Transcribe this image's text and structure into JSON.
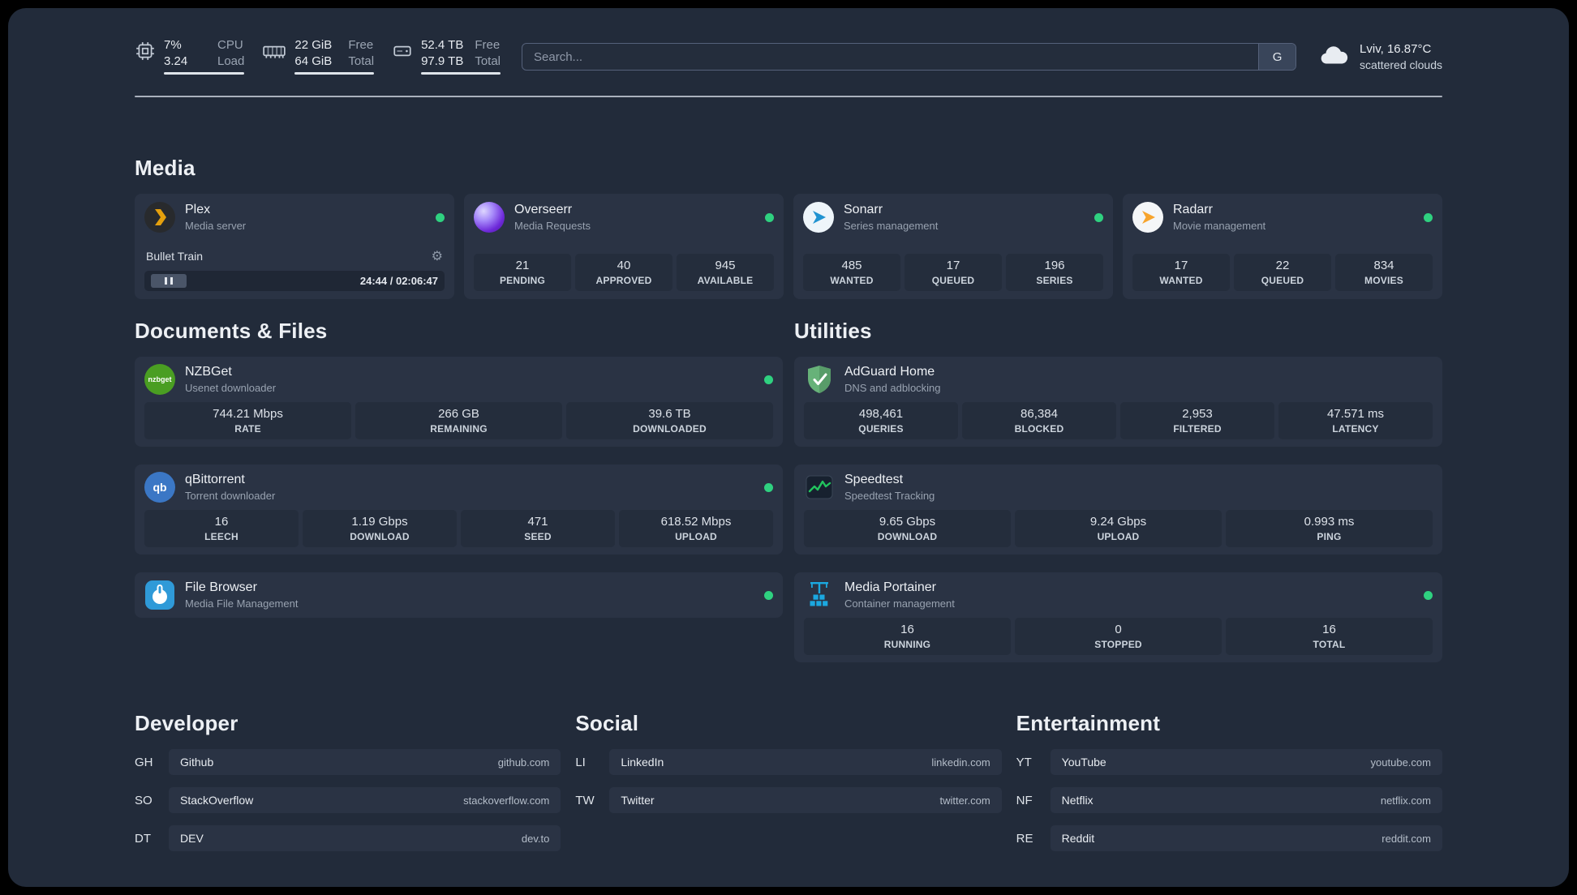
{
  "colors": {
    "status_online": "#2fd180",
    "plex_gold": "#e5a00d",
    "sonarr_blue": "#2193d1",
    "radarr_orange": "#f7a42d",
    "nzbget_green": "#4a9e22",
    "qbittorrent_blue": "#3b77c5",
    "overseerr_purple": "#6d28d9",
    "adguard_green": "#67b279",
    "speedtest_green": "#22c55e",
    "portainer_blue": "#1ba8e0",
    "filebrowser_blue": "#2f9ad8"
  },
  "topbar": {
    "cpu": {
      "rows": [
        {
          "value": "7%",
          "label": "CPU"
        },
        {
          "value": "3.24",
          "label": "Load"
        }
      ]
    },
    "memory": {
      "rows": [
        {
          "value": "22 GiB",
          "label": "Free"
        },
        {
          "value": "64 GiB",
          "label": "Total"
        }
      ]
    },
    "disk": {
      "rows": [
        {
          "value": "52.4 TB",
          "label": "Free"
        },
        {
          "value": "97.9 TB",
          "label": "Total"
        }
      ]
    },
    "search": {
      "placeholder": "Search...",
      "provider_button": "G"
    },
    "weather": {
      "location": "Lviv, 16.87°C",
      "condition": "scattered clouds"
    }
  },
  "icons": {
    "nzbget_text": "nzbget",
    "qbittorrent_text": "qb"
  },
  "sections": {
    "media": {
      "title": "Media",
      "plex": {
        "name": "Plex",
        "subtitle": "Media server",
        "now_playing": "Bullet Train",
        "time": "24:44 / 02:06:47"
      },
      "overseerr": {
        "name": "Overseerr",
        "subtitle": "Media Requests",
        "stats": [
          {
            "value": "21",
            "label": "PENDING"
          },
          {
            "value": "40",
            "label": "APPROVED"
          },
          {
            "value": "945",
            "label": "AVAILABLE"
          }
        ]
      },
      "sonarr": {
        "name": "Sonarr",
        "subtitle": "Series management",
        "stats": [
          {
            "value": "485",
            "label": "WANTED"
          },
          {
            "value": "17",
            "label": "QUEUED"
          },
          {
            "value": "196",
            "label": "SERIES"
          }
        ]
      },
      "radarr": {
        "name": "Radarr",
        "subtitle": "Movie management",
        "stats": [
          {
            "value": "17",
            "label": "WANTED"
          },
          {
            "value": "22",
            "label": "QUEUED"
          },
          {
            "value": "834",
            "label": "MOVIES"
          }
        ]
      }
    },
    "documents": {
      "title": "Documents & Files",
      "nzbget": {
        "name": "NZBGet",
        "subtitle": "Usenet downloader",
        "stats": [
          {
            "value": "744.21 Mbps",
            "label": "RATE"
          },
          {
            "value": "266 GB",
            "label": "REMAINING"
          },
          {
            "value": "39.6 TB",
            "label": "DOWNLOADED"
          }
        ]
      },
      "qbittorrent": {
        "name": "qBittorrent",
        "subtitle": "Torrent downloader",
        "stats": [
          {
            "value": "16",
            "label": "LEECH"
          },
          {
            "value": "1.19 Gbps",
            "label": "DOWNLOAD"
          },
          {
            "value": "471",
            "label": "SEED"
          },
          {
            "value": "618.52 Mbps",
            "label": "UPLOAD"
          }
        ]
      },
      "filebrowser": {
        "name": "File Browser",
        "subtitle": "Media File Management"
      }
    },
    "utilities": {
      "title": "Utilities",
      "adguard": {
        "name": "AdGuard Home",
        "subtitle": "DNS and adblocking",
        "stats": [
          {
            "value": "498,461",
            "label": "QUERIES"
          },
          {
            "value": "86,384",
            "label": "BLOCKED"
          },
          {
            "value": "2,953",
            "label": "FILTERED"
          },
          {
            "value": "47.571 ms",
            "label": "LATENCY"
          }
        ]
      },
      "speedtest": {
        "name": "Speedtest",
        "subtitle": "Speedtest Tracking",
        "stats": [
          {
            "value": "9.65 Gbps",
            "label": "DOWNLOAD"
          },
          {
            "value": "9.24 Gbps",
            "label": "UPLOAD"
          },
          {
            "value": "0.993 ms",
            "label": "PING"
          }
        ]
      },
      "portainer": {
        "name": "Media Portainer",
        "subtitle": "Container management",
        "stats": [
          {
            "value": "16",
            "label": "RUNNING"
          },
          {
            "value": "0",
            "label": "STOPPED"
          },
          {
            "value": "16",
            "label": "TOTAL"
          }
        ]
      }
    }
  },
  "bookmarks": {
    "developer": {
      "title": "Developer",
      "items": [
        {
          "abbr": "GH",
          "name": "Github",
          "domain": "github.com"
        },
        {
          "abbr": "SO",
          "name": "StackOverflow",
          "domain": "stackoverflow.com"
        },
        {
          "abbr": "DT",
          "name": "DEV",
          "domain": "dev.to"
        }
      ]
    },
    "social": {
      "title": "Social",
      "items": [
        {
          "abbr": "LI",
          "name": "LinkedIn",
          "domain": "linkedin.com"
        },
        {
          "abbr": "TW",
          "name": "Twitter",
          "domain": "twitter.com"
        }
      ]
    },
    "entertainment": {
      "title": "Entertainment",
      "items": [
        {
          "abbr": "YT",
          "name": "YouTube",
          "domain": "youtube.com"
        },
        {
          "abbr": "NF",
          "name": "Netflix",
          "domain": "netflix.com"
        },
        {
          "abbr": "RE",
          "name": "Reddit",
          "domain": "reddit.com"
        }
      ]
    }
  }
}
